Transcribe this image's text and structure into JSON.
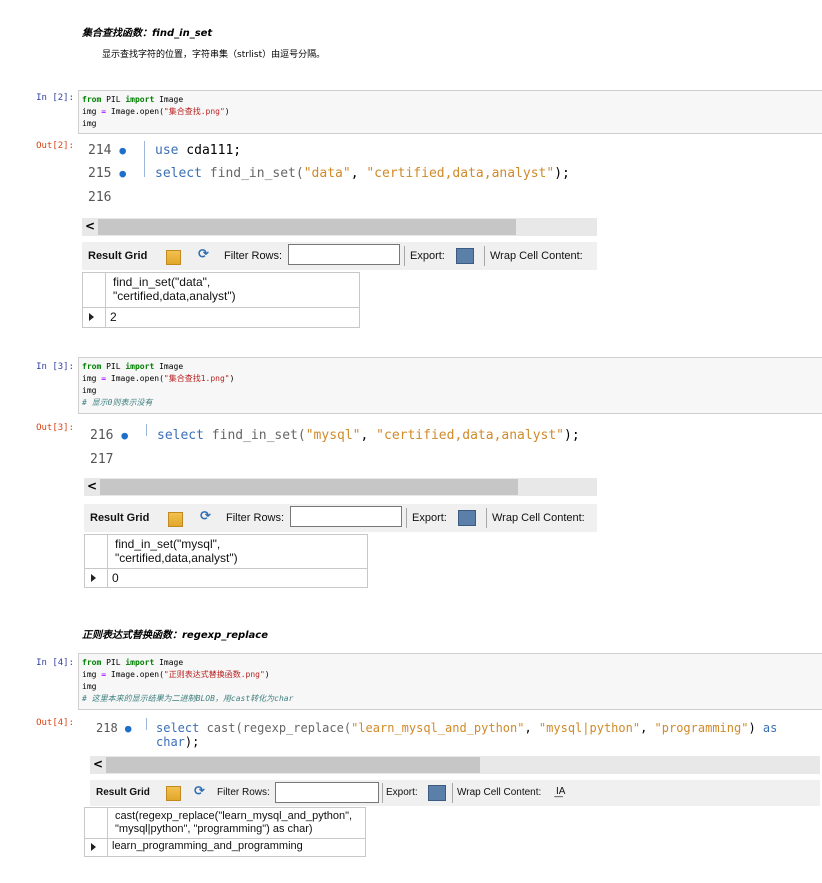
{
  "md1": {
    "heading": "集合查找函数：find_in_set",
    "text": "显示查找字符的位置，字符串集（strlist）由逗号分隔。"
  },
  "cells": [
    {
      "in_prompt": "In  [2]:",
      "out_prompt": "Out[2]:",
      "code_lines": [
        [
          [
            "from",
            "kw"
          ],
          [
            " PIL ",
            ""
          ],
          [
            "import",
            "kw"
          ],
          [
            " Image",
            ""
          ]
        ],
        [
          [
            "img ",
            ""
          ],
          [
            "=",
            "op"
          ],
          [
            " Image.open(",
            ""
          ],
          [
            "\"集合查找.png\"",
            "str"
          ],
          [
            ")",
            ""
          ]
        ],
        [
          [
            "img",
            ""
          ]
        ]
      ],
      "wb_lines": [
        {
          "num": "214",
          "dot": "●",
          "tokens": [
            [
              "use",
              "skw"
            ],
            [
              " cda111;",
              ""
            ]
          ]
        },
        {
          "num": "215",
          "dot": "●",
          "tokens": [
            [
              "select",
              "skw"
            ],
            [
              " find_in_set(",
              "sfn"
            ],
            [
              "\"data\"",
              "sstr"
            ],
            [
              ", ",
              ""
            ],
            [
              "\"certified,data,analyst\"",
              "sstr"
            ],
            [
              ");",
              ""
            ]
          ]
        },
        {
          "num": "216",
          "dot": "",
          "tokens": []
        }
      ],
      "scroll_arrow": "<",
      "grid_header": "find_in_set(\"data\",\n\"certified,data,analyst\")",
      "grid_value": "2"
    },
    {
      "in_prompt": "In  [3]:",
      "out_prompt": "Out[3]:",
      "code_lines": [
        [
          [
            "from",
            "kw"
          ],
          [
            " PIL ",
            ""
          ],
          [
            "import",
            "kw"
          ],
          [
            " Image",
            ""
          ]
        ],
        [
          [
            "img ",
            ""
          ],
          [
            "=",
            "op"
          ],
          [
            " Image.open(",
            ""
          ],
          [
            "\"集合查找1.png\"",
            "str"
          ],
          [
            ")",
            ""
          ]
        ],
        [
          [
            "img",
            ""
          ]
        ],
        [
          [
            "# 显示0则表示没有",
            "cm"
          ]
        ]
      ],
      "wb_lines": [
        {
          "num": "216",
          "dot": "●",
          "tokens": [
            [
              "select",
              "skw"
            ],
            [
              " find_in_set(",
              "sfn"
            ],
            [
              "\"mysql\"",
              "sstr"
            ],
            [
              ", ",
              ""
            ],
            [
              "\"certified,data,analyst\"",
              "sstr"
            ],
            [
              ");",
              ""
            ]
          ]
        },
        {
          "num": "217",
          "dot": "",
          "tokens": []
        }
      ],
      "scroll_arrow": "<",
      "grid_header": "find_in_set(\"mysql\",\n\"certified,data,analyst\")",
      "grid_value": "0"
    },
    {
      "in_prompt": "In  [4]:",
      "out_prompt": "Out[4]:",
      "code_lines": [
        [
          [
            "from",
            "kw"
          ],
          [
            " PIL ",
            ""
          ],
          [
            "import",
            "kw"
          ],
          [
            " Image",
            ""
          ]
        ],
        [
          [
            "img ",
            ""
          ],
          [
            "=",
            "op"
          ],
          [
            " Image.open(",
            ""
          ],
          [
            "\"正则表达式替换函数.png\"",
            "str"
          ],
          [
            ")",
            ""
          ]
        ],
        [
          [
            "img",
            ""
          ]
        ],
        [
          [
            "# 这里本来的显示结果为二进制BLOB，用cast转化为char",
            "cm"
          ]
        ]
      ],
      "wb_lines": [
        {
          "num": "218",
          "dot": "●",
          "tokens": [
            [
              "select",
              "skw"
            ],
            [
              " cast(regexp_replace(",
              "sfn"
            ],
            [
              "\"learn_mysql_and_python\"",
              "sstr"
            ],
            [
              ", ",
              ""
            ],
            [
              "\"mysql|python\"",
              "sstr"
            ],
            [
              ", ",
              ""
            ],
            [
              "\"programming\"",
              "sstr"
            ],
            [
              ") ",
              ""
            ],
            [
              "as",
              "skw"
            ],
            [
              " ",
              ""
            ],
            [
              "char",
              "skw"
            ],
            [
              ");",
              ""
            ]
          ]
        }
      ],
      "scroll_arrow": "<",
      "grid_header": "cast(regexp_replace(\"learn_mysql_and_python\",\n\"mysql|python\", \"programming\") as char)",
      "grid_value": "learn_programming_and_programming"
    }
  ],
  "md2": {
    "heading": "正则表达式替换函数：regexp_replace"
  },
  "toolbar": {
    "result_grid": "Result Grid",
    "filter_rows": "Filter Rows:",
    "export": "Export:",
    "wrap": "Wrap Cell Content:",
    "wrap_icon": "I͟A"
  },
  "colors": {
    "in_prompt": "#303f9f",
    "out_prompt": "#d84315",
    "sql_keyword": "#3b6fb5",
    "sql_string": "#d08a2a"
  }
}
